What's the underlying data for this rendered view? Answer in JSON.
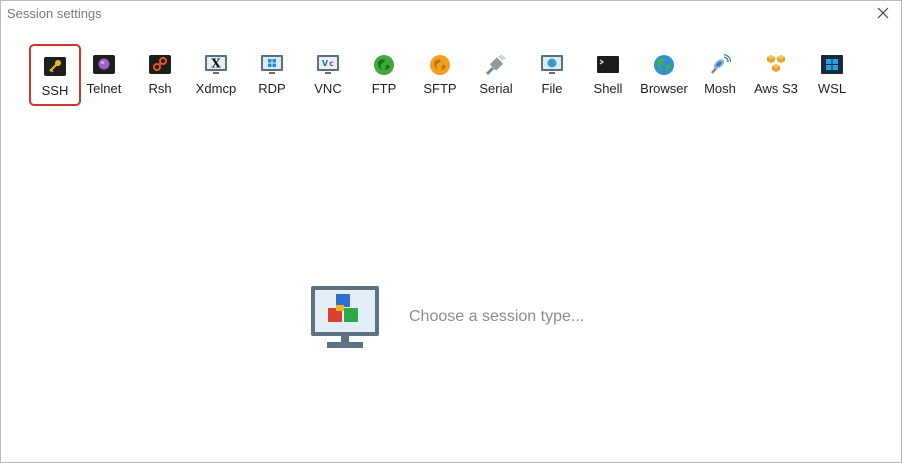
{
  "window": {
    "title": "Session settings",
    "close_icon": "close-icon"
  },
  "toolbar": {
    "items": [
      {
        "label": "SSH",
        "icon": "ssh-key-icon",
        "selected": true
      },
      {
        "label": "Telnet",
        "icon": "telnet-icon"
      },
      {
        "label": "Rsh",
        "icon": "rsh-icon"
      },
      {
        "label": "Xdmcp",
        "icon": "xdmcp-icon"
      },
      {
        "label": "RDP",
        "icon": "rdp-icon"
      },
      {
        "label": "VNC",
        "icon": "vnc-icon"
      },
      {
        "label": "FTP",
        "icon": "ftp-icon"
      },
      {
        "label": "SFTP",
        "icon": "sftp-icon"
      },
      {
        "label": "Serial",
        "icon": "serial-icon"
      },
      {
        "label": "File",
        "icon": "file-icon"
      },
      {
        "label": "Shell",
        "icon": "shell-icon"
      },
      {
        "label": "Browser",
        "icon": "browser-icon"
      },
      {
        "label": "Mosh",
        "icon": "mosh-icon"
      },
      {
        "label": "Aws S3",
        "icon": "aws-s3-icon"
      },
      {
        "label": "WSL",
        "icon": "wsl-icon"
      }
    ]
  },
  "main": {
    "prompt": "Choose a session type..."
  },
  "colors": {
    "selected_border": "#c8372a",
    "prompt_text": "#8c8c8c"
  }
}
